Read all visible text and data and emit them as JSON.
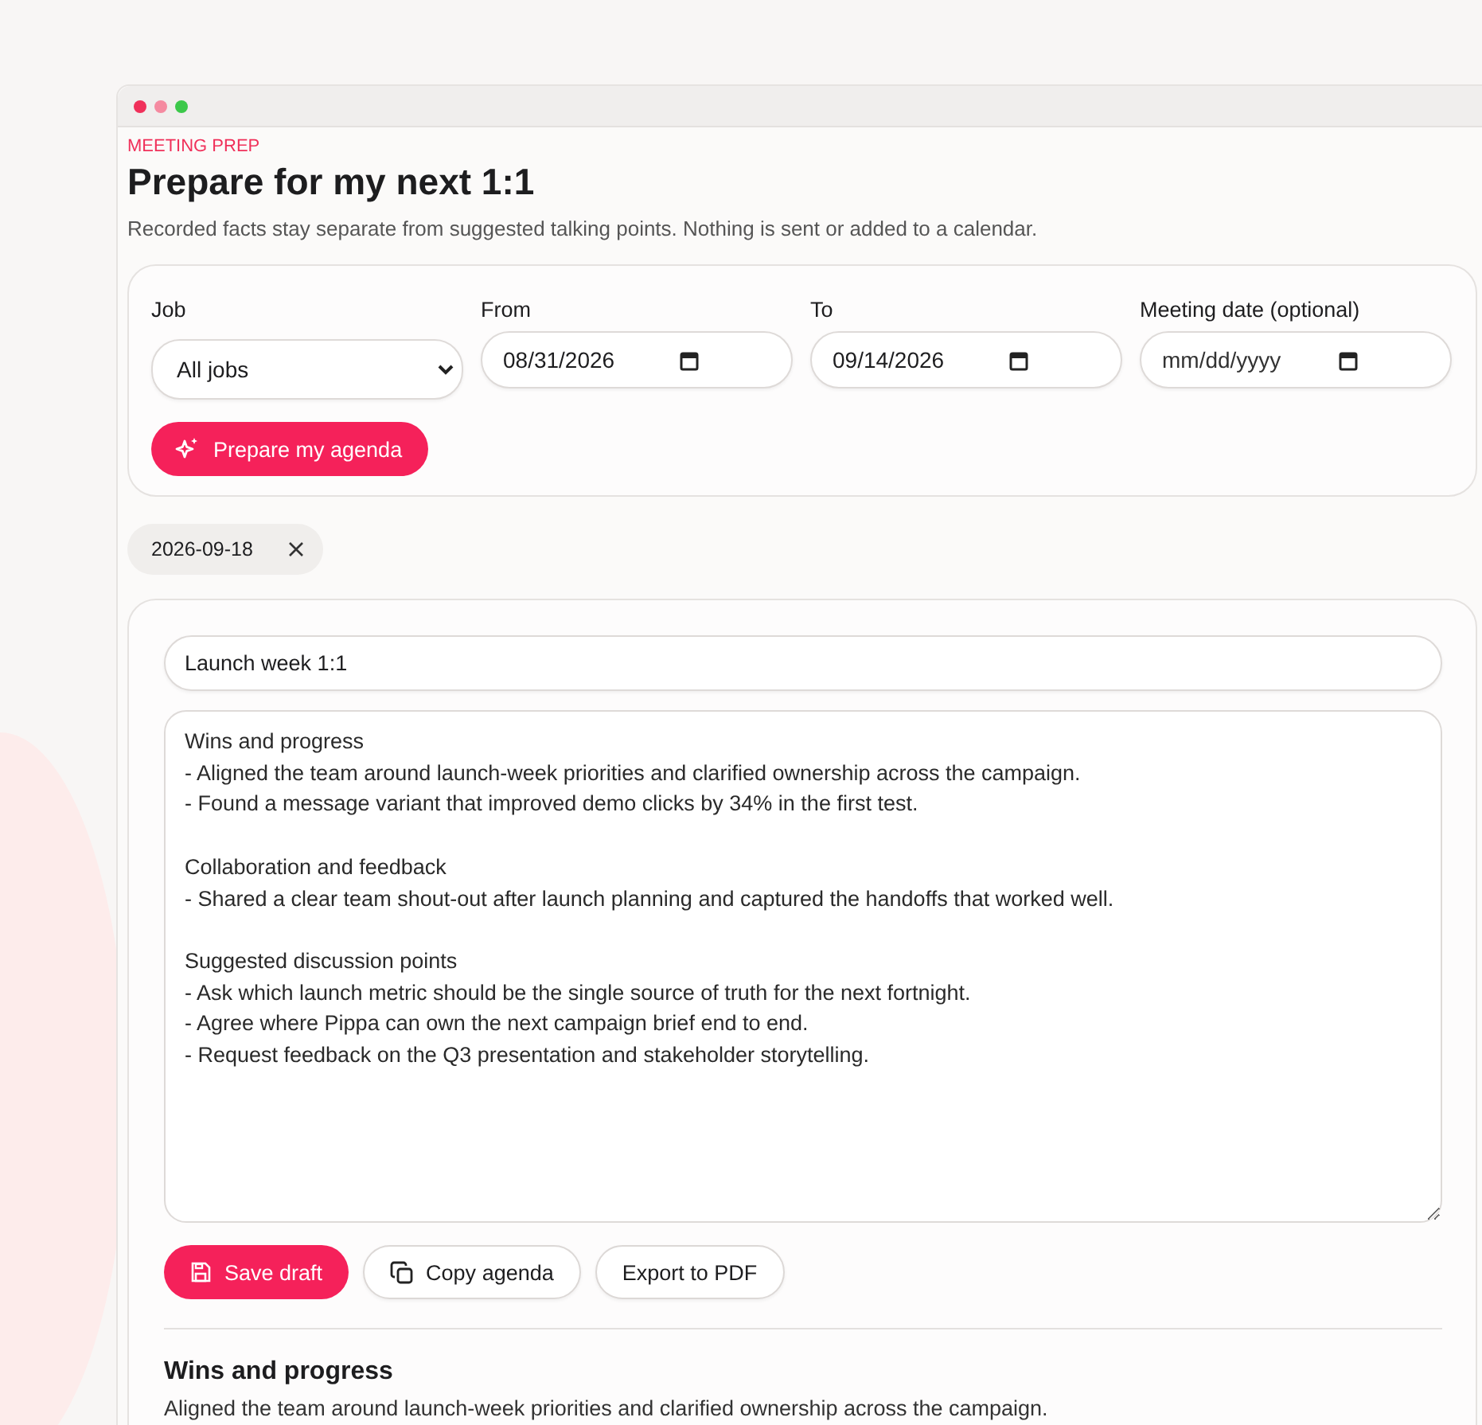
{
  "window": {
    "controls": [
      {
        "color": "#f0305a"
      },
      {
        "color": "#f58aa0"
      },
      {
        "color": "#3cc84a"
      }
    ]
  },
  "eyebrow": "MEETING PREP",
  "title": "Prepare for my next 1:1",
  "subtitle": "Recorded facts stay separate from suggested talking points. Nothing is sent or added to a calendar.",
  "filters": [
    {
      "kind": "select",
      "label": "Job",
      "value": "All jobs"
    },
    {
      "kind": "date",
      "label": "From",
      "value": "08/31/2026"
    },
    {
      "kind": "date",
      "label": "To",
      "value": "09/14/2026"
    },
    {
      "kind": "date",
      "label": "Meeting date (optional)",
      "placeholder": "mm/dd/yyyy"
    }
  ],
  "prepare_button": "Prepare my agenda",
  "chips": [
    {
      "label": "2026-09-18"
    }
  ],
  "editor": {
    "title_value": "Launch week 1:1",
    "body_value": "Wins and progress\n- Aligned the team around launch-week priorities and clarified ownership across the campaign.\n- Found a message variant that improved demo clicks by 34% in the first test.\n\nCollaboration and feedback\n- Shared a clear team shout-out after launch planning and captured the handoffs that worked well.\n\nSuggested discussion points\n- Ask which launch metric should be the single source of truth for the next fortnight.\n- Agree where Pippa can own the next campaign brief end to end.\n- Request feedback on the Q3 presentation and stakeholder storytelling.",
    "actions": [
      {
        "kind": "save",
        "label": "Save draft"
      },
      {
        "kind": "copy",
        "label": "Copy agenda"
      },
      {
        "kind": "export",
        "label": "Export to PDF"
      }
    ]
  },
  "preview": {
    "heading": "Wins and progress",
    "text": "Aligned the team around launch-week priorities and clarified ownership across the campaign."
  }
}
